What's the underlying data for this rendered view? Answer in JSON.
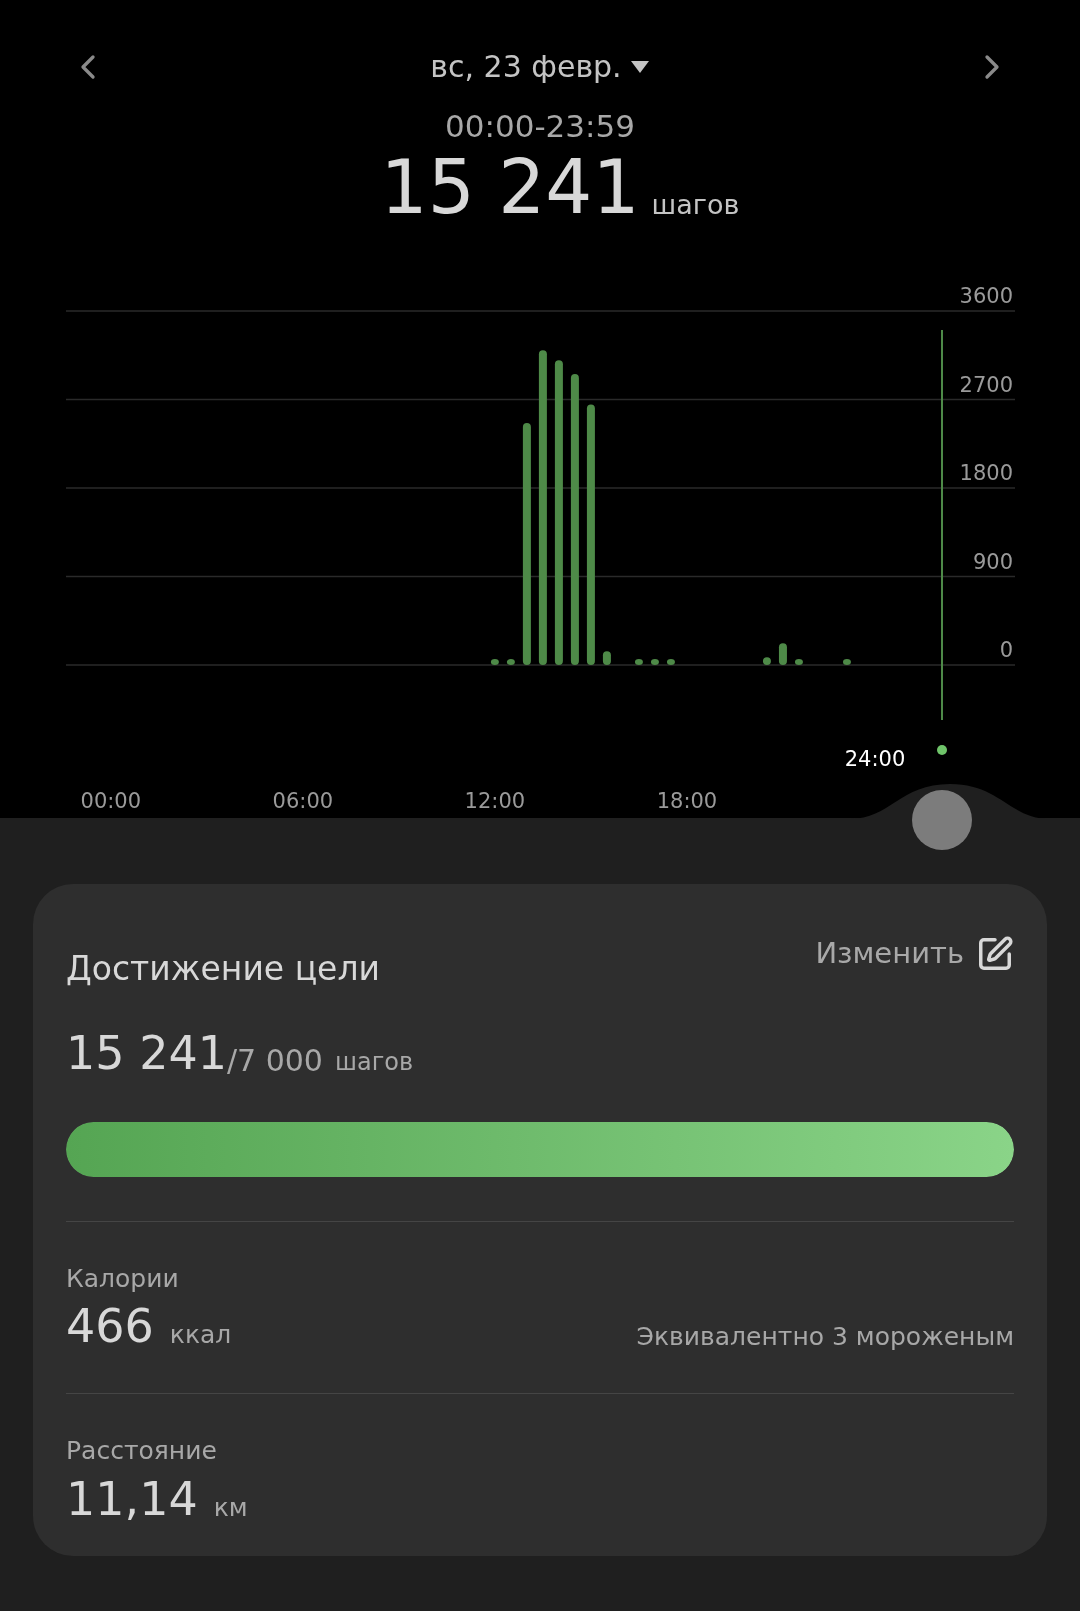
{
  "header": {
    "date": "вс, 23 февр.",
    "range": "00:00-23:59",
    "steps": "15 241",
    "steps_unit": "шагов"
  },
  "chart_data": {
    "type": "bar",
    "grid": true,
    "x": [
      12,
      12.5,
      13,
      13.5,
      14,
      14.5,
      15,
      15.5,
      16.5,
      17,
      17.5,
      20.5,
      21,
      21.5,
      23
    ],
    "series": [
      {
        "color": "#4e8a48",
        "values": [
          60,
          60,
          2460,
          3200,
          3100,
          2960,
          2650,
          140,
          60,
          60,
          60,
          80,
          220,
          60,
          60
        ]
      }
    ],
    "xlim": [
      -1.4,
      28.25
    ],
    "ylim": [
      0,
      3600
    ],
    "yticks": [
      0,
      900,
      1800,
      2700,
      3600
    ],
    "xticks": [
      {
        "value": 0,
        "label": "00:00"
      },
      {
        "value": 6,
        "label": "06:00"
      },
      {
        "value": 12,
        "label": "12:00"
      },
      {
        "value": 18,
        "label": "18:00"
      }
    ]
  },
  "cursor": {
    "label": "24:00"
  },
  "goal": {
    "title": "Достижение цели",
    "edit": "Изменить",
    "value": "15 241",
    "target": "/7 000",
    "unit": "шагов",
    "level": 1
  },
  "stats": [
    {
      "label": "Калории",
      "value": "466",
      "unit": "ккал",
      "note": "Эквивалентно 3 мороженым"
    },
    {
      "label": "Расстояние",
      "value": "11,14",
      "unit": "км"
    }
  ]
}
